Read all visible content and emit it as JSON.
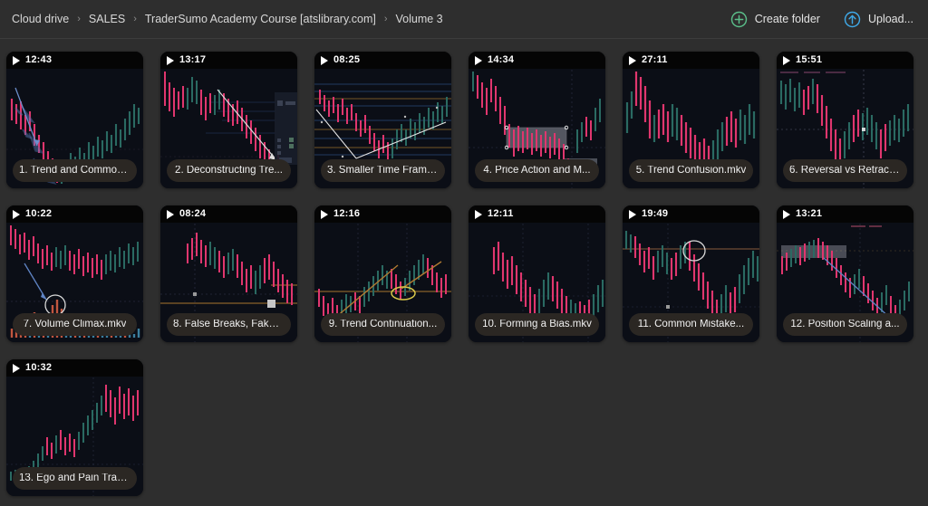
{
  "header": {
    "breadcrumb": {
      "name": "breadcrumb",
      "separator": "›",
      "items": [
        {
          "label": "Cloud drive"
        },
        {
          "label": "SALES"
        },
        {
          "label": "TraderSumo Academy Course [atslibrary.com]"
        },
        {
          "label": "Volume 3"
        }
      ]
    },
    "actions": [
      {
        "label": "Create folder",
        "icon": "circle-plus-icon",
        "color": "#5bbf8a",
        "name": "create-folder-button"
      },
      {
        "label": "Upload...",
        "icon": "circle-arrow-up-icon",
        "color": "#3fa9e8",
        "name": "upload-button"
      }
    ]
  },
  "colors": {
    "page_background": "#2e2e2e",
    "header_background": "#2e2e2e",
    "card_background": "#16171c",
    "thumb_background": "#0b0e16",
    "duration_badge_background": "#050505",
    "title_pill_background": "#2b2723",
    "text_primary": "#e3e3e3",
    "breadcrumb_text": "#d6d6d6",
    "breadcrumb_separator": "#8b8b8b",
    "candle_down": "#e0366e",
    "candle_up": "#1f5f58",
    "trendline_blue": "#5f7fb5",
    "trendline_white": "#e8e8e8",
    "trendline_orange": "#b07a32",
    "annotation_yellow": "#d9c84a",
    "create_folder_accent": "#5bbf8a",
    "upload_accent": "#3fa9e8"
  },
  "files": [
    {
      "index": 1,
      "duration": "12:43",
      "title": "1. Trend and Common...",
      "name": "file-card-1"
    },
    {
      "index": 2,
      "duration": "13:17",
      "title": "2. Deconstructing Tre...",
      "name": "file-card-2"
    },
    {
      "index": 3,
      "duration": "08:25",
      "title": "3. Smaller Time Frame...",
      "name": "file-card-3"
    },
    {
      "index": 4,
      "duration": "14:34",
      "title": "4. Price Action and M...",
      "name": "file-card-4"
    },
    {
      "index": 5,
      "duration": "27:11",
      "title": "5. Trend Confusion.mkv",
      "name": "file-card-5"
    },
    {
      "index": 6,
      "duration": "15:51",
      "title": "6. Reversal vs Retrace...",
      "name": "file-card-6"
    },
    {
      "index": 7,
      "duration": "10:22",
      "title": "7. Volume Climax.mkv",
      "name": "file-card-7"
    },
    {
      "index": 8,
      "duration": "08:24",
      "title": "8. False Breaks, Fake-...",
      "name": "file-card-8"
    },
    {
      "index": 9,
      "duration": "12:16",
      "title": "9. Trend Continuation...",
      "name": "file-card-9"
    },
    {
      "index": 10,
      "duration": "12:11",
      "title": "10. Forming a Bias.mkv",
      "name": "file-card-10"
    },
    {
      "index": 11,
      "duration": "19:49",
      "title": "11. Common Mistake...",
      "name": "file-card-11"
    },
    {
      "index": 12,
      "duration": "13:21",
      "title": "12. Position Scaling a...",
      "name": "file-card-12"
    },
    {
      "index": 13,
      "duration": "10:32",
      "title": "13. Ego and Pain Tradi...",
      "name": "file-card-13"
    }
  ]
}
